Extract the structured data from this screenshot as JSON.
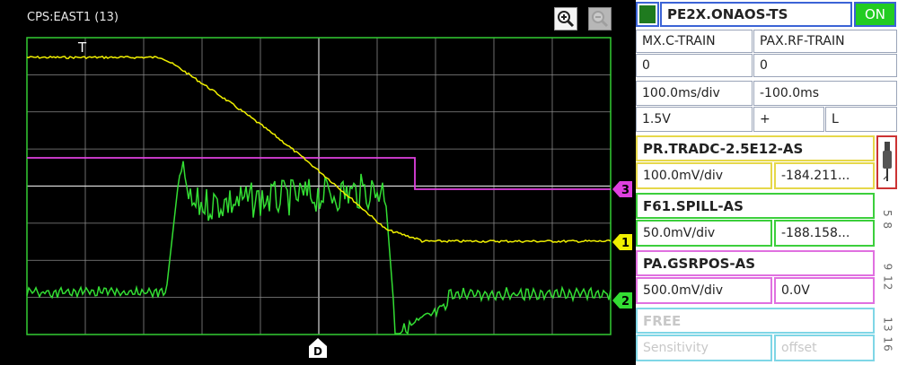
{
  "scope": {
    "title": "CPS:EAST1 (13)",
    "trigger_marker": "T",
    "delay_marker": "D",
    "zoom_in_icon": "zoom-in-icon",
    "zoom_out_icon": "zoom-out-icon",
    "channel_markers": [
      {
        "label": "3",
        "color": "#e040e0"
      },
      {
        "label": "1",
        "color": "#f0f000"
      },
      {
        "label": "2",
        "color": "#33dd33"
      }
    ]
  },
  "panel": {
    "device": "PE2X.ONAOS-TS",
    "on_label": "ON",
    "train_left": "MX.C-TRAIN",
    "train_right": "PAX.RF-TRAIN",
    "train_left_value": "0",
    "train_right_value": "0",
    "timebase": "100.0ms/div",
    "time_offset": "-100.0ms",
    "trigger_level": "1.5V",
    "trigger_slope": "+",
    "trigger_mode": "L",
    "channels": [
      {
        "name": "PR.TRADC-2.5E12-AS",
        "sensitivity": "100.0mV/div",
        "offset": "-184.211...",
        "tab": ""
      },
      {
        "name": "F61.SPILL-AS",
        "sensitivity": "50.0mV/div",
        "offset": "-188.158...",
        "tab": "5 8"
      },
      {
        "name": "PA.GSRPOS-AS",
        "sensitivity": "500.0mV/div",
        "offset": "0.0V",
        "tab": "9 12"
      },
      {
        "name": "FREE",
        "sensitivity": "Sensitivity",
        "offset": "offset",
        "tab": "13 16"
      }
    ],
    "colors": {
      "green_on": "#22cc22",
      "dark_green": "#1f7a1f",
      "probe": "#cc3333"
    }
  }
}
